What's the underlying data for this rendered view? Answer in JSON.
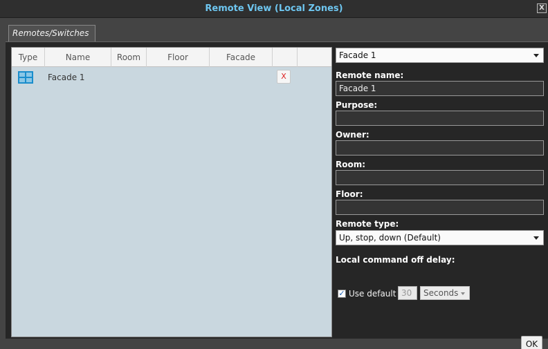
{
  "window": {
    "title": "Remote View (Local Zones)",
    "close_label": "X"
  },
  "tabs": [
    {
      "label": "Remotes/Switches"
    }
  ],
  "grid": {
    "columns": [
      "Type",
      "Name",
      "Room",
      "Floor",
      "Facade",
      ""
    ],
    "rows": [
      {
        "type_icon": "window-grid-icon",
        "name": "Facade 1",
        "room": "",
        "floor": "",
        "facade": "",
        "delete_label": "X"
      }
    ]
  },
  "details": {
    "selector_value": "Facade 1",
    "remote_name_label": "Remote name:",
    "remote_name_value": "Facade 1",
    "purpose_label": "Purpose:",
    "purpose_value": "",
    "owner_label": "Owner:",
    "owner_value": "",
    "room_label": "Room:",
    "room_value": "",
    "floor_label": "Floor:",
    "floor_value": "",
    "remote_type_label": "Remote type:",
    "remote_type_value": "Up, stop, down (Default)",
    "delay_label": "Local command off delay:",
    "use_default_label": "Use default",
    "use_default_checked": true,
    "delay_value": "30",
    "delay_unit": "Seconds"
  },
  "buttons": {
    "ok_label": "OK"
  },
  "colors": {
    "title_accent": "#6ec6f0",
    "grid_bg": "#c9d7df",
    "delete_red": "#dd2222"
  }
}
